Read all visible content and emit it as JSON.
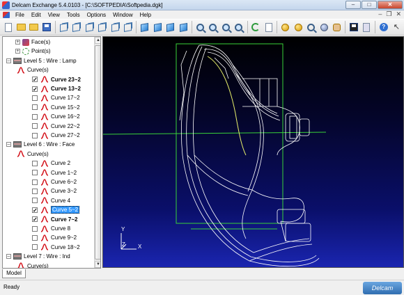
{
  "window": {
    "title": "Delcam Exchange 5.4.0103 - [C:\\SOFTPEDIA\\Softpedia.dgk]",
    "minimize": "–",
    "maximize": "□",
    "close": "✕"
  },
  "menu": {
    "items": [
      "File",
      "Edit",
      "View",
      "Tools",
      "Options",
      "Window",
      "Help"
    ],
    "right_minimize": "–",
    "right_restore": "❐",
    "right_close": "✕"
  },
  "toolbar": {
    "icons": [
      "new-document-icon",
      "open-folder-icon",
      "open-recent-icon",
      "save-icon",
      "view-iso-1-icon",
      "view-iso-2-icon",
      "view-iso-3-icon",
      "view-iso-4-icon",
      "view-iso-5-icon",
      "view-iso-6-icon",
      "view-top-icon",
      "view-front-icon",
      "view-side-icon",
      "view-bottom-icon",
      "zoom-icon",
      "zoom-in-icon",
      "zoom-out-icon",
      "zoom-fit-icon",
      "refresh-icon",
      "redraw-icon",
      "shade-icon",
      "shade-2-icon",
      "wire-sphere-icon",
      "globe-icon",
      "hand-icon",
      "select-icon",
      "layers-icon",
      "help-icon",
      "arrow-icon"
    ]
  },
  "tree": {
    "rows": [
      {
        "type": "leaf",
        "label": "Face(s)",
        "icon": "face-icon"
      },
      {
        "type": "leaf",
        "label": "Point(s)",
        "icon": "point-icon"
      },
      {
        "type": "level",
        "label": "Level 5 : Wire : Lamp"
      },
      {
        "type": "group",
        "label": "Curve(s)"
      },
      {
        "type": "curve",
        "label": "Curve 23~2",
        "checked": true,
        "bold": true
      },
      {
        "type": "curve",
        "label": "Curve 13~2",
        "checked": true,
        "bold": true
      },
      {
        "type": "curve",
        "label": "Curve 17~2",
        "checked": false
      },
      {
        "type": "curve",
        "label": "Curve 15~2",
        "checked": false
      },
      {
        "type": "curve",
        "label": "Curve 16~2",
        "checked": false
      },
      {
        "type": "curve",
        "label": "Curve 22~2",
        "checked": false
      },
      {
        "type": "curve",
        "label": "Curve 27~2",
        "checked": false
      },
      {
        "type": "level",
        "label": "Level 6 : Wire : Face"
      },
      {
        "type": "group",
        "label": "Curve(s)"
      },
      {
        "type": "curve",
        "label": "Curve 2",
        "checked": false
      },
      {
        "type": "curve",
        "label": "Curve 1~2",
        "checked": false
      },
      {
        "type": "curve",
        "label": "Curve 6~2",
        "checked": false
      },
      {
        "type": "curve",
        "label": "Curve 3~2",
        "checked": false
      },
      {
        "type": "curve",
        "label": "Curve 4",
        "checked": false
      },
      {
        "type": "curve",
        "label": "Curve 5~2",
        "checked": true,
        "selected": true
      },
      {
        "type": "curve",
        "label": "Curve 7~2",
        "checked": true,
        "bold": true
      },
      {
        "type": "curve",
        "label": "Curve 8",
        "checked": false
      },
      {
        "type": "curve",
        "label": "Curve 9~2",
        "checked": false
      },
      {
        "type": "curve",
        "label": "Curve 18~2",
        "checked": false
      },
      {
        "type": "level",
        "label": "Level 7 : Wire : Ind"
      },
      {
        "type": "group",
        "label": "Curve(s)"
      }
    ]
  },
  "tabs": {
    "model": "Model"
  },
  "viewport": {
    "axis_y": "Y",
    "axis_z": "Z",
    "axis_x": "X"
  },
  "status": {
    "text": "Ready",
    "brand": "Delcam"
  },
  "colors": {
    "wireframe": "#ffffff",
    "bbox": "#39d239",
    "highlight": "#e8f06a",
    "curve_icon": "#d4141c"
  }
}
